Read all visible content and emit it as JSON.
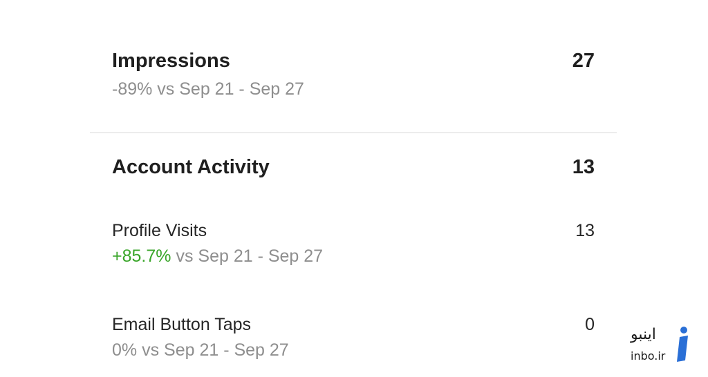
{
  "impressions": {
    "title": "Impressions",
    "value": "27",
    "change": "-89% vs Sep 21 - Sep 27"
  },
  "account_activity": {
    "title": "Account Activity",
    "value": "13"
  },
  "profile_visits": {
    "title": "Profile Visits",
    "value": "13",
    "change_pct": "+85.7%",
    "change_rest": " vs Sep 21 - Sep 27",
    "change_color": "#3aa62a"
  },
  "email_taps": {
    "title": "Email Button Taps",
    "value": "0",
    "change": "0% vs Sep 21 - Sep 27"
  },
  "watermark": {
    "persian": "اینبو",
    "latin": "inbo.ir",
    "logo_icon": "info-i-icon",
    "logo_color": "#2a6fd6"
  }
}
